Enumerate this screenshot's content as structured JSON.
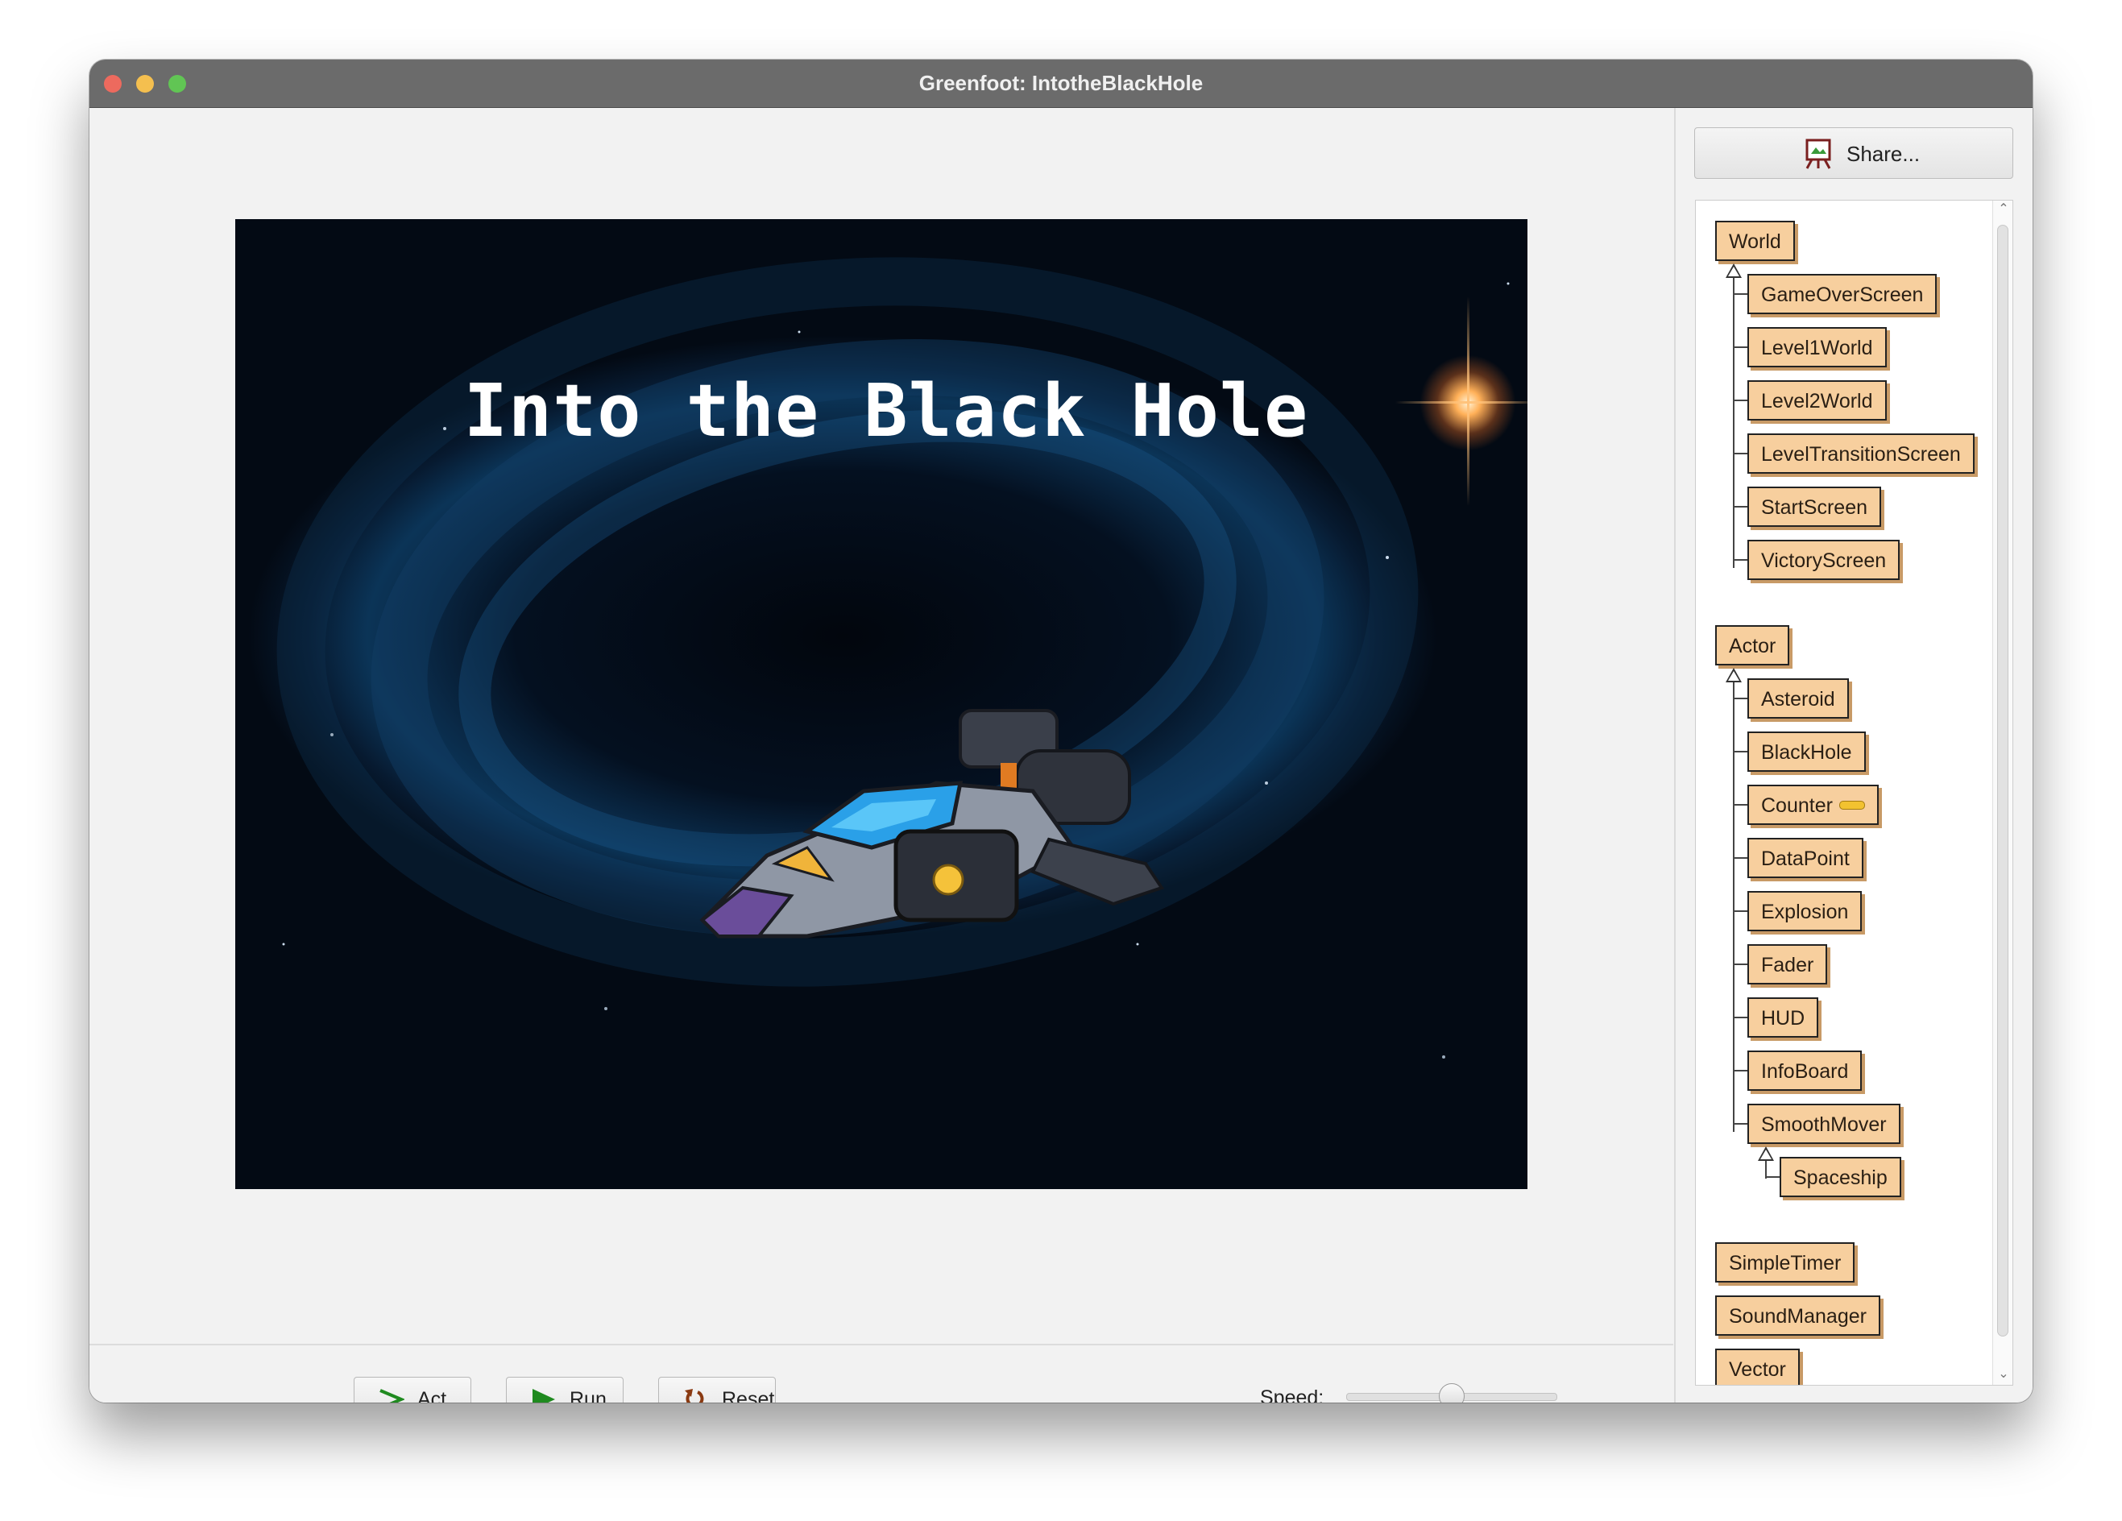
{
  "window": {
    "title": "Greenfoot: IntotheBlackHole"
  },
  "world": {
    "title": "Into the Black Hole"
  },
  "controls": {
    "act_label": "Act",
    "run_label": "Run",
    "reset_label": "Reset",
    "speed_label": "Speed:",
    "speed_level_fraction": 0.5
  },
  "sidebar": {
    "share_label": "Share...",
    "classes": {
      "world_root": "World",
      "world_subclasses": [
        "GameOverScreen",
        "Level1World",
        "Level2World",
        "LevelTransitionScreen",
        "StartScreen",
        "VictoryScreen"
      ],
      "actor_root": "Actor",
      "actor_subclasses": [
        "Asteroid",
        "BlackHole",
        "Counter",
        "DataPoint",
        "Explosion",
        "Fader",
        "HUD",
        "InfoBoard",
        "SmoothMover"
      ],
      "smoothmover_subclasses": [
        "Spaceship"
      ],
      "other_classes": [
        "SimpleTimer",
        "SoundManager",
        "Vector"
      ]
    }
  },
  "icons": {
    "act": "act-arrow-icon",
    "run": "play-icon",
    "reset": "reset-icon",
    "share": "share-easel-icon"
  },
  "colors": {
    "class_box": "#f7cf9e",
    "title_bar": "#6b6b6b",
    "run_green": "#1f8a1f",
    "reset_brown": "#8a3a12"
  }
}
